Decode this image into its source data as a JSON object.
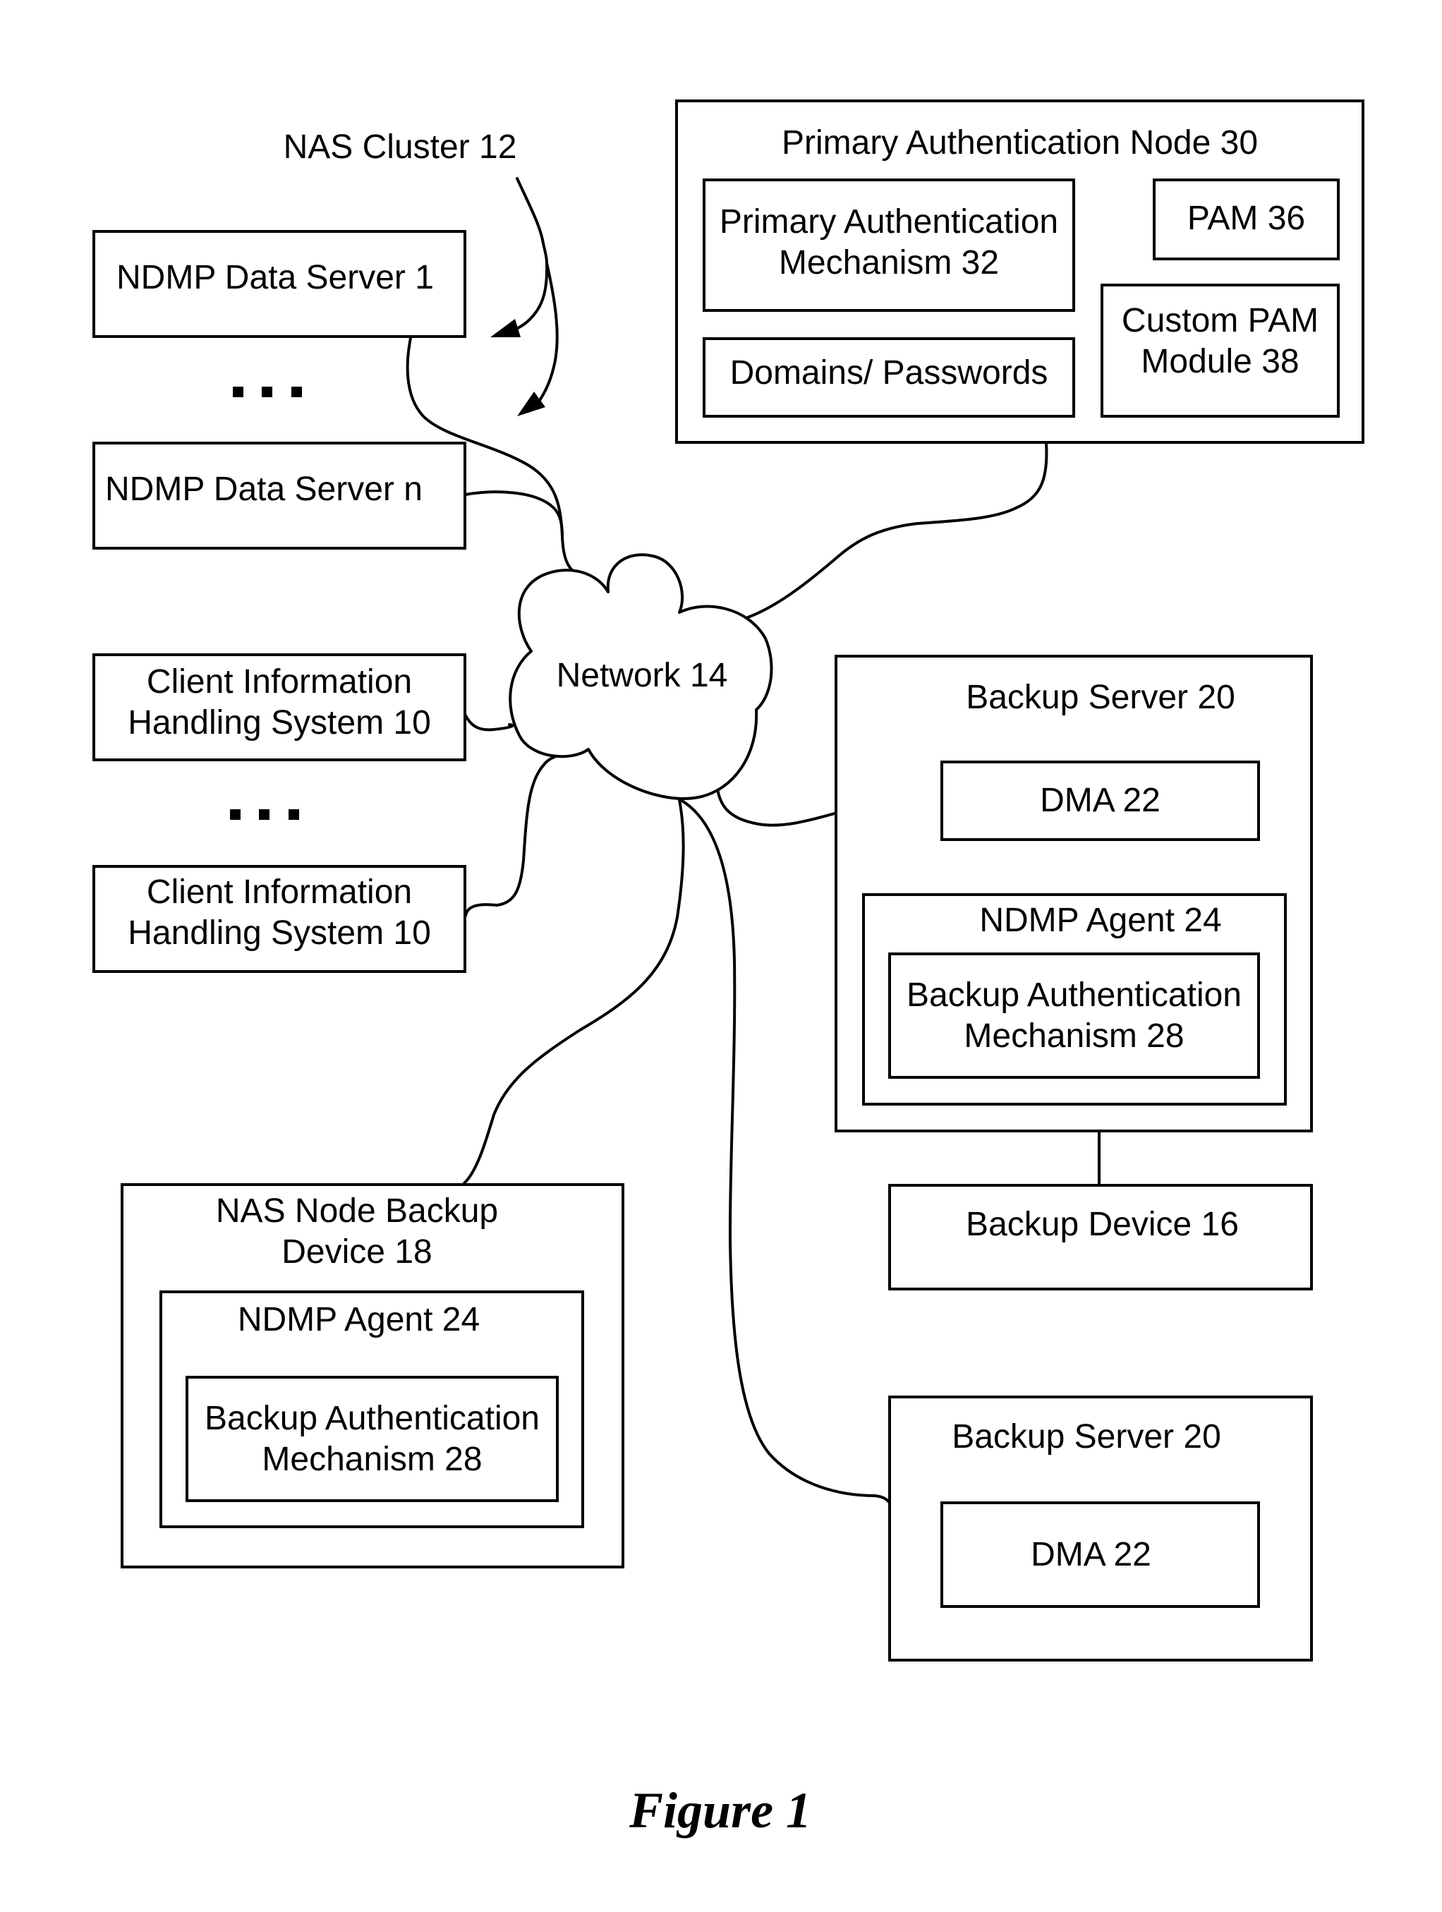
{
  "figure": {
    "caption": "Figure 1",
    "nas_cluster_label": "NAS Cluster 12",
    "ellipsis_icon": "vertical-ellipsis"
  },
  "nodes": {
    "ndmp_data_server_1": {
      "label": "NDMP Data Server 1"
    },
    "ndmp_data_server_n": {
      "label": "NDMP Data Server n"
    },
    "client_1": {
      "line1": "Client Information",
      "line2": "Handling System 10"
    },
    "client_2": {
      "line1": "Client Information",
      "line2": "Handling System 10"
    },
    "network": {
      "label": "Network 14",
      "icon": "cloud-icon"
    },
    "primary_auth_node": {
      "title": "Primary Authentication Node 30",
      "pam32": {
        "line1": "Primary Authentication",
        "line2": "Mechanism 32"
      },
      "pam36": {
        "label": "PAM 36"
      },
      "domains": {
        "label": "Domains/ Passwords"
      },
      "custom_pam": {
        "line1": "Custom PAM",
        "line2": "Module 38"
      }
    },
    "backup_server_top": {
      "title": "Backup Server 20",
      "dma": {
        "label": "DMA 22"
      },
      "ndmp_agent": {
        "title": "NDMP Agent 24",
        "bam": {
          "line1": "Backup Authentication",
          "line2": "Mechanism 28"
        }
      }
    },
    "backup_device": {
      "label": "Backup Device 16"
    },
    "nas_node_backup": {
      "line1": "NAS Node Backup",
      "line2": "Device 18",
      "ndmp_agent": {
        "title": "NDMP Agent 24",
        "bam": {
          "line1": "Backup Authentication",
          "line2": "Mechanism 28"
        }
      }
    },
    "backup_server_bottom": {
      "title": "Backup Server 20",
      "dma": {
        "label": "DMA 22"
      }
    }
  },
  "connections": [
    {
      "from": "ndmp_data_server_1",
      "to": "network"
    },
    {
      "from": "ndmp_data_server_n",
      "to": "network"
    },
    {
      "from": "client_1",
      "to": "network"
    },
    {
      "from": "client_2",
      "to": "network"
    },
    {
      "from": "primary_auth_node",
      "to": "network"
    },
    {
      "from": "backup_server_top",
      "to": "network"
    },
    {
      "from": "nas_node_backup",
      "to": "network"
    },
    {
      "from": "backup_server_bottom",
      "to": "network"
    },
    {
      "from": "backup_server_top",
      "to": "backup_device"
    }
  ],
  "annotations": [
    {
      "label_ref": "figure.nas_cluster_label",
      "points_to": [
        "ndmp_data_server_1",
        "ndmp_data_server_n"
      ]
    }
  ]
}
